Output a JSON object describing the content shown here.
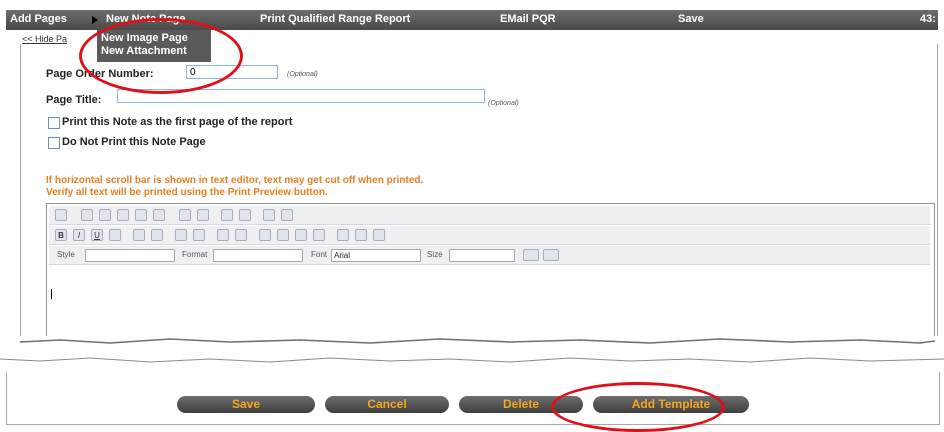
{
  "menu": {
    "add_pages": "Add Pages",
    "new_note_page": "New Note Page",
    "print_report": "Print Qualified Range Report",
    "email_pqr": "EMail PQR",
    "save": "Save",
    "right_trunc": "43:"
  },
  "dropdown": {
    "items": [
      "New Image Page",
      "New Attachment"
    ]
  },
  "hide_link": "<< Hide Pa",
  "form": {
    "page_order_label": "Page Order Number:",
    "page_order_value": "0",
    "page_order_hint": "(Optional)",
    "page_title_label": "Page Title:",
    "page_title_value": "",
    "page_title_hint": "(Optional)",
    "check_first_page": "Print this Note as the first page of the report",
    "check_do_not_print": "Do Not Print this Note Page",
    "warning_line1": "If horizontal scroll bar is shown in text editor, text may get cut off when printed.",
    "warning_line2": "Verify all text will be printed using the Print Preview button."
  },
  "editor": {
    "style_label": "Style",
    "format_label": "Format",
    "font_label": "Font",
    "font_value": "Arial",
    "size_label": "Size"
  },
  "buttons": {
    "save": "Save",
    "cancel": "Cancel",
    "delete": "Delete",
    "add_template": "Add Template"
  },
  "colors": {
    "menu_bg": "#555555",
    "button_text": "#f5a623",
    "warning": "#e67e22",
    "highlight_ring": "#e0101a"
  }
}
